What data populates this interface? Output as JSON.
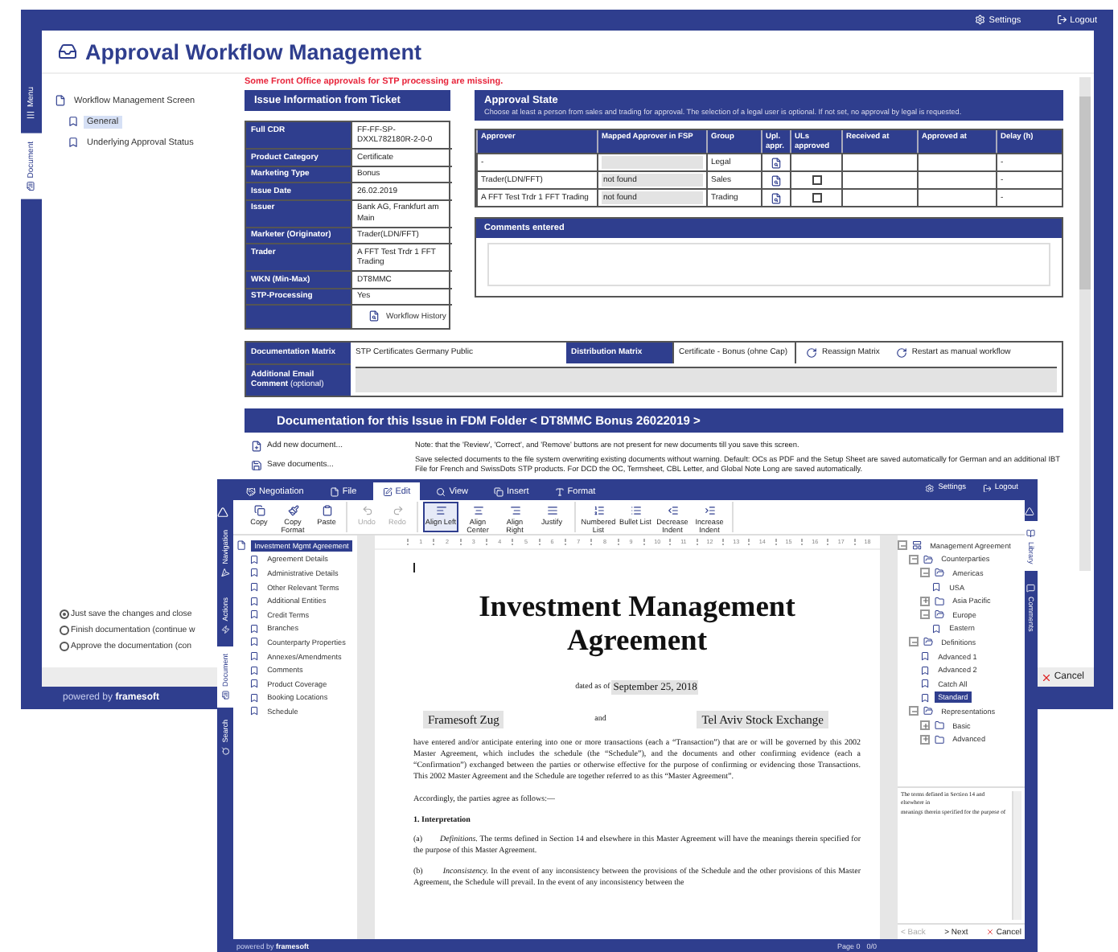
{
  "approval_window": {
    "top_links": [
      {
        "kind": "settings",
        "label": "Settings"
      },
      {
        "kind": "logout",
        "label": "Logout"
      }
    ],
    "side_tabs": [
      {
        "kind": "menu",
        "label": "Menu",
        "selected": false
      },
      {
        "kind": "document",
        "label": "Document",
        "selected": true
      }
    ],
    "title": "Approval Workflow Management",
    "tree": [
      {
        "kind": "file",
        "label": "Workflow Management Screen",
        "selected": false,
        "children": [
          {
            "kind": "bookmark",
            "label": "General",
            "selected": true
          },
          {
            "kind": "bookmark",
            "label": "Underlying Approval Status",
            "selected": false
          }
        ]
      }
    ],
    "warning": "Some Front Office approvals for STP processing are missing.",
    "issue_info": {
      "title": "Issue Information from Ticket",
      "rows": [
        {
          "label": "Full CDR",
          "value": "FF-FF-SP-DXXL782180R-2-0-0"
        },
        {
          "label": "Product Category",
          "value": "Certificate"
        },
        {
          "label": "Marketing Type",
          "value": "Bonus"
        },
        {
          "label": "Issue Date",
          "value": "26.02.2019"
        },
        {
          "label": "Issuer",
          "value": "Bank AG, Frankfurt am Main"
        },
        {
          "label": "Marketer (Originator)",
          "value": "Trader(LDN/FFT)"
        },
        {
          "label": "Trader",
          "value": "A FFT Test Trdr 1 FFT Trading"
        },
        {
          "label": "WKN (Min-Max)",
          "value": "DT8MMC"
        },
        {
          "label": "STP-Processing",
          "value": "Yes"
        }
      ],
      "link": "Workflow History"
    },
    "approval_state": {
      "title": "Approval State",
      "subtitle": "Choose at least a person from sales and trading for approval. The selection of a legal user is optional. If not set, no approval by legal is requested.",
      "columns": [
        "Approver",
        "Mapped Approver in FSP",
        "Group",
        "Upl. appr.",
        "ULs approved",
        "Received at",
        "Approved at",
        "Delay (h)"
      ],
      "rows": [
        {
          "approver": "-",
          "group": "Legal",
          "delay": "-"
        },
        {
          "approver": "Trader(LDN/FFT)",
          "mapped": "not found",
          "group": "Sales",
          "ul_approved": false,
          "delay": "-"
        },
        {
          "approver": "A FFT Test Trdr 1 FFT Trading",
          "mapped": "not found",
          "group": "Trading",
          "ul_approved": false,
          "delay": "-"
        }
      ]
    },
    "comments": {
      "title": "Comments entered"
    },
    "matrix": {
      "label": "Documentation Matrix",
      "value": "STP Certificates Germany Public",
      "dist_label": "Distribution Matrix",
      "dist_value": "Certificate - Bonus (ohne Cap)",
      "actions": [
        "Reassign Matrix",
        "Restart as manual workflow"
      ],
      "email_label": "**Additional Email Comment** (optional)"
    },
    "documentation": {
      "title": "Documentation for this Issue in FDM Folder  < DT8MMC Bonus 26022019 >",
      "actions": [
        {
          "kind": "add",
          "label": "Add new document..."
        },
        {
          "kind": "save",
          "label": "Save documents..."
        }
      ],
      "notes": [
        "Note: that the 'Review', 'Correct', and 'Remove' buttons are not present for new documents till you save this screen.",
        "Save selected documents to the file system overwriting existing documents without warning. Default: OCs as PDF and the Setup Sheet are saved automatically for German and an additional IBT File for French and SwissDots STP products. For DCD the OC, Termsheet, CBL Letter, and Global Note Long are saved automatically."
      ]
    },
    "save_options": [
      {
        "label": "Just save the changes and close",
        "selected": true
      },
      {
        "label": "Finish documentation (continue w",
        "selected": false
      },
      {
        "label": "Approve the documentation (con",
        "selected": false
      }
    ],
    "footer": {
      "prefix": "powered by",
      "brand": "framesoft"
    },
    "cancel": "Cancel"
  },
  "editor_window": {
    "menu_tabs": [
      {
        "kind": "negotiation",
        "label": "Negotiation",
        "selected": false
      },
      {
        "kind": "file",
        "label": "File",
        "selected": false
      },
      {
        "kind": "edit",
        "label": "Edit",
        "selected": true
      },
      {
        "kind": "view",
        "label": "View",
        "selected": false
      },
      {
        "kind": "insert",
        "label": "Insert",
        "selected": false
      },
      {
        "kind": "format",
        "label": "Format",
        "selected": false
      }
    ],
    "top_links": [
      {
        "kind": "settings",
        "label": "Settings"
      },
      {
        "kind": "logout",
        "label": "Logout"
      }
    ],
    "ribbon_groups": [
      [
        {
          "kind": "copy",
          "label": "Copy",
          "disabled": false,
          "selected": false
        },
        {
          "kind": "copy_format",
          "label": "Copy Format",
          "disabled": false,
          "selected": false
        },
        {
          "kind": "paste",
          "label": "Paste",
          "disabled": false,
          "selected": false
        }
      ],
      [
        {
          "kind": "undo",
          "label": "Undo",
          "disabled": true,
          "selected": false
        },
        {
          "kind": "redo",
          "label": "Redo",
          "disabled": true,
          "selected": false
        }
      ],
      [
        {
          "kind": "align_left",
          "label": "Align Left",
          "disabled": false,
          "selected": true
        },
        {
          "kind": "align_center",
          "label": "Align Center",
          "disabled": false,
          "selected": false
        },
        {
          "kind": "align_right",
          "label": "Align Right",
          "disabled": false,
          "selected": false
        },
        {
          "kind": "justify",
          "label": "Justify",
          "disabled": false,
          "selected": false
        }
      ],
      [
        {
          "kind": "numbered",
          "label": "Numbered List",
          "disabled": false,
          "selected": false
        },
        {
          "kind": "bullet",
          "label": "Bullet List",
          "disabled": false,
          "selected": false
        },
        {
          "kind": "outdent",
          "label": "Decrease Indent",
          "disabled": false,
          "selected": false
        },
        {
          "kind": "indent",
          "label": "Increase Indent",
          "disabled": false,
          "selected": false
        }
      ]
    ],
    "left_tabs": [
      {
        "kind": "navigation",
        "label": "Navigation",
        "selected": false
      },
      {
        "kind": "actions",
        "label": "Actions",
        "selected": false
      },
      {
        "kind": "document",
        "label": "Document",
        "selected": true
      },
      {
        "kind": "search",
        "label": "Search",
        "selected": false
      }
    ],
    "right_tabs": [
      {
        "kind": "library",
        "label": "Library",
        "selected": true
      },
      {
        "kind": "comments",
        "label": "Comments",
        "selected": false
      }
    ],
    "nav_tree": [
      {
        "kind": "file",
        "label": "Investment Mgmt Agreement",
        "selected": true,
        "children": [
          {
            "kind": "bookmark",
            "label": "Agreement Details",
            "selected": false
          },
          {
            "kind": "bookmark",
            "label": "Administrative Details",
            "selected": false
          },
          {
            "kind": "bookmark",
            "label": "Other Relevant Terms",
            "selected": false
          },
          {
            "kind": "bookmark",
            "label": "Additional Entities",
            "selected": false
          },
          {
            "kind": "bookmark",
            "label": "Credit Terms",
            "selected": false
          },
          {
            "kind": "bookmark",
            "label": "Branches",
            "selected": false
          },
          {
            "kind": "bookmark",
            "label": "Counterparty Properties",
            "selected": false
          },
          {
            "kind": "bookmark",
            "label": "Annexes/Amendments",
            "selected": false
          },
          {
            "kind": "bookmark",
            "label": "Comments",
            "selected": false
          },
          {
            "kind": "bookmark",
            "label": "Product Coverage",
            "selected": false
          },
          {
            "kind": "bookmark",
            "label": "Booking Locations",
            "selected": false
          },
          {
            "kind": "bookmark",
            "label": "Schedule",
            "selected": false
          }
        ]
      }
    ],
    "ruler_marks": [
      "1",
      "2",
      "3",
      "4",
      "5",
      "6",
      "7",
      "8",
      "9",
      "10",
      "11",
      "12",
      "13",
      "14",
      "15",
      "16",
      "17",
      "18"
    ],
    "document": {
      "title": "Investment Management Agreement",
      "dated_prefix": "dated as of",
      "date": "September 25, 2018",
      "parties": [
        {
          "kind": "party",
          "text": "Framesoft Zug"
        },
        {
          "kind": "joiner",
          "text": "and"
        },
        {
          "kind": "party",
          "text": "Tel Aviv Stock Exchange"
        }
      ],
      "paragraphs": [
        {
          "kind": "body",
          "text": "have entered and/or anticipate entering into one or more transactions (each a “Transaction”) that are or will be governed by this 2002 Master Agreement, which includes the schedule (the “Schedule”), and the documents and other confirming evidence (each a “Confirmation”) exchanged between the parties or otherwise effective for the purpose of confirming or evidencing those Transactions. This 2002 Master Agreement and the Schedule are together referred to as this “Master Agreement”."
        },
        {
          "kind": "body",
          "text": "Accordingly, the parties agree as follows:—"
        },
        {
          "kind": "heading",
          "text": "1. Interpretation"
        },
        {
          "kind": "clause",
          "text": "(a)        *Definitions.* The terms defined in Section 14 and elsewhere in this Master Agreement will have the meanings therein specified for the purpose of this Master Agreement."
        },
        {
          "kind": "clause",
          "text": "(b)        *Inconsistency.* In the event of any inconsistency between the provisions of the Schedule and the other provisions of this Master Agreement, the Schedule will prevail. In the event of any inconsistency between the"
        }
      ]
    },
    "library_tree": [
      {
        "kind": "root",
        "label": "Management Agreement",
        "expanded": true,
        "selected": false,
        "children": [
          {
            "kind": "folder",
            "label": "Counterparties",
            "expanded": true,
            "selected": false,
            "children": [
              {
                "kind": "folder",
                "label": "Americas",
                "expanded": true,
                "selected": false,
                "children": [
                  {
                    "kind": "bookmark",
                    "label": "USA",
                    "selected": false
                  }
                ]
              },
              {
                "kind": "folder",
                "label": "Asia Pacific",
                "expanded": false,
                "selected": false
              },
              {
                "kind": "folder",
                "label": "Europe",
                "expanded": true,
                "selected": false,
                "children": [
                  {
                    "kind": "bookmark",
                    "label": "Eastern",
                    "selected": false
                  }
                ]
              }
            ]
          },
          {
            "kind": "folder",
            "label": "Definitions",
            "expanded": true,
            "selected": false,
            "children": [
              {
                "kind": "bookmark",
                "label": "Advanced 1",
                "selected": false
              },
              {
                "kind": "bookmark",
                "label": "Advanced 2",
                "selected": false
              },
              {
                "kind": "bookmark",
                "label": "Catch All",
                "selected": false
              },
              {
                "kind": "bookmark",
                "label": "Standard",
                "selected": true
              }
            ]
          },
          {
            "kind": "folder",
            "label": "Representations",
            "expanded": true,
            "selected": false,
            "children": [
              {
                "kind": "folder",
                "label": "Basic",
                "expanded": false,
                "selected": false
              },
              {
                "kind": "folder",
                "label": "Advanced",
                "expanded": false,
                "selected": false
              }
            ]
          }
        ]
      }
    ],
    "preview": [
      "The terms defined in Section 14 and elsewhere in",
      "meanings therein specified for the purpose of"
    ],
    "nav_buttons": [
      {
        "kind": "back",
        "label": "< Back",
        "disabled": true
      },
      {
        "kind": "next",
        "label": "> Next",
        "disabled": false
      },
      {
        "kind": "cancel",
        "label": "Cancel",
        "disabled": false
      }
    ],
    "footer": {
      "prefix": "powered by",
      "brand": "framesoft",
      "page": "Page 0",
      "count": "0/0"
    }
  }
}
